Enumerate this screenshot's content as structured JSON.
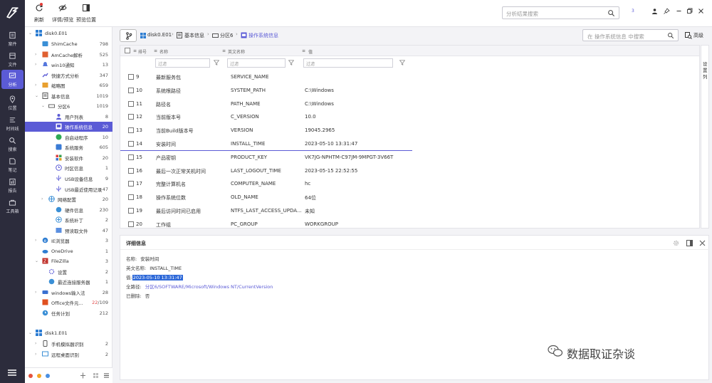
{
  "toolbar": {
    "refresh_label": "刷新",
    "detail_label": "详情/预览",
    "preview_pos_label": "预览位置",
    "search_placeholder": "分析结果搜索",
    "counter": "3"
  },
  "nav": {
    "items": [
      {
        "icon": "file-case-icon",
        "label": "案件"
      },
      {
        "icon": "file-icon",
        "label": "文件"
      },
      {
        "icon": "analysis-icon",
        "label": "分析"
      },
      {
        "icon": "location-icon",
        "label": "位置"
      },
      {
        "icon": "timeline-icon",
        "label": "时间线"
      },
      {
        "icon": "search-icon",
        "label": "搜索"
      },
      {
        "icon": "note-icon",
        "label": "笔记"
      },
      {
        "icon": "report-icon",
        "label": "报告"
      },
      {
        "icon": "toolbox-icon",
        "label": "工具箱"
      }
    ]
  },
  "tree": {
    "nodes": [
      {
        "label": "disk0.E01",
        "count": ""
      },
      {
        "label": "ShimCache",
        "count": "798"
      },
      {
        "label": "AmCache解析",
        "count": "525"
      },
      {
        "label": "win10通知",
        "count": "13"
      },
      {
        "label": "快捷方式分析",
        "count": "347"
      },
      {
        "label": "缩略图",
        "count": "659"
      },
      {
        "label": "基本信息",
        "count": "1019"
      },
      {
        "label": "分区6",
        "count": "1019"
      },
      {
        "label": "用户列表",
        "count": "8"
      },
      {
        "label": "操作系统信息",
        "count": "20"
      },
      {
        "label": "自启动程序",
        "count": "10"
      },
      {
        "label": "系统服务",
        "count": "605"
      },
      {
        "label": "安装软件",
        "count": "20"
      },
      {
        "label": "时区信息",
        "count": "1"
      },
      {
        "label": "USB设备信息",
        "count": "9"
      },
      {
        "label": "USB最近使用记录",
        "count": "47"
      },
      {
        "label": "网络配置",
        "count": "20"
      },
      {
        "label": "硬件信息",
        "count": "230"
      },
      {
        "label": "系统补丁",
        "count": "2"
      },
      {
        "label": "预读取文件",
        "count": "47"
      },
      {
        "label": "IE浏览器",
        "count": "3"
      },
      {
        "label": "OneDrive",
        "count": "1"
      },
      {
        "label": "FileZilla",
        "count": "3"
      },
      {
        "label": "设置",
        "count": "2"
      },
      {
        "label": "最近连接服务器",
        "count": "1"
      },
      {
        "label": "windows输入法",
        "count": "28"
      },
      {
        "label": "Office文件元...",
        "count": "/109",
        "count_red": "22"
      },
      {
        "label": "任务计划",
        "count": "212"
      },
      {
        "label": "disk1.E01",
        "count": ""
      },
      {
        "label": "手机模拟器识别",
        "count": "2"
      },
      {
        "label": "远程桌面识别",
        "count": "2"
      }
    ]
  },
  "breadcrumb": {
    "items": [
      "disk0.E01",
      "基本信息",
      "分区6",
      "操作系统信息"
    ],
    "search_placeholder": "在 操作系统信息 中搜索",
    "advanced_label": "高级"
  },
  "grid": {
    "headers": {
      "index": "排号",
      "name": "名称",
      "en_name": "英文名称",
      "value": "值"
    },
    "filter_placeholder": "过滤",
    "rows": [
      {
        "index": "9",
        "name": "最新服务包",
        "en": "SERVICE_NAME",
        "value": ""
      },
      {
        "index": "10",
        "name": "系统根路径",
        "en": "SYSTEM_PATH",
        "value": "C:\\Windows"
      },
      {
        "index": "11",
        "name": "路径名",
        "en": "PATH_NAME",
        "value": "C:\\Windows"
      },
      {
        "index": "12",
        "name": "当前版本号",
        "en": "C_VERSION",
        "value": "10.0"
      },
      {
        "index": "13",
        "name": "当前Build版本号",
        "en": "VERSION",
        "value": "19045.2965"
      },
      {
        "index": "14",
        "name": "安装时间",
        "en": "INSTALL_TIME",
        "value": "2023-05-10 13:31:47"
      },
      {
        "index": "15",
        "name": "产品密钥",
        "en": "PRODUCT_KEY",
        "value": "VK7JG-NPHTM-C97JM-9MPGT-3V66T"
      },
      {
        "index": "16",
        "name": "最后一次正常关机时间",
        "en": "LAST_LOGOUT_TIME",
        "value": "2023-05-15 22:52:55"
      },
      {
        "index": "17",
        "name": "完整计算机名",
        "en": "COMPUTER_NAME",
        "value": "hc"
      },
      {
        "index": "18",
        "name": "操作系统位数",
        "en": "OLD_NAME",
        "value": "64位"
      },
      {
        "index": "19",
        "name": "最后访问时间已启用",
        "en": "NTFS_LAST_ACCESS_UPDA...",
        "value": "未知"
      },
      {
        "index": "20",
        "name": "工作组",
        "en": "PC_GROUP",
        "value": "WORKGROUP"
      }
    ],
    "side_label": "设置列"
  },
  "detail": {
    "title": "详细信息",
    "name_k": "名称:",
    "name_v": "安装时间",
    "en_k": "英文名称:",
    "en_v": "INSTALL_TIME",
    "value_k": "值:",
    "value_v": "2023-05-10 13:31:47",
    "path_k": "全路径:",
    "path_v": "分区6/SOFTWARE/Microsoft/Windows NT/CurrentVersion",
    "deleted_k": "已删除:",
    "deleted_v": "否"
  },
  "watermark": "数据取证杂谈",
  "colors": {
    "accent": "#5b5bd6",
    "nav_bg": "#2c2c3c"
  }
}
